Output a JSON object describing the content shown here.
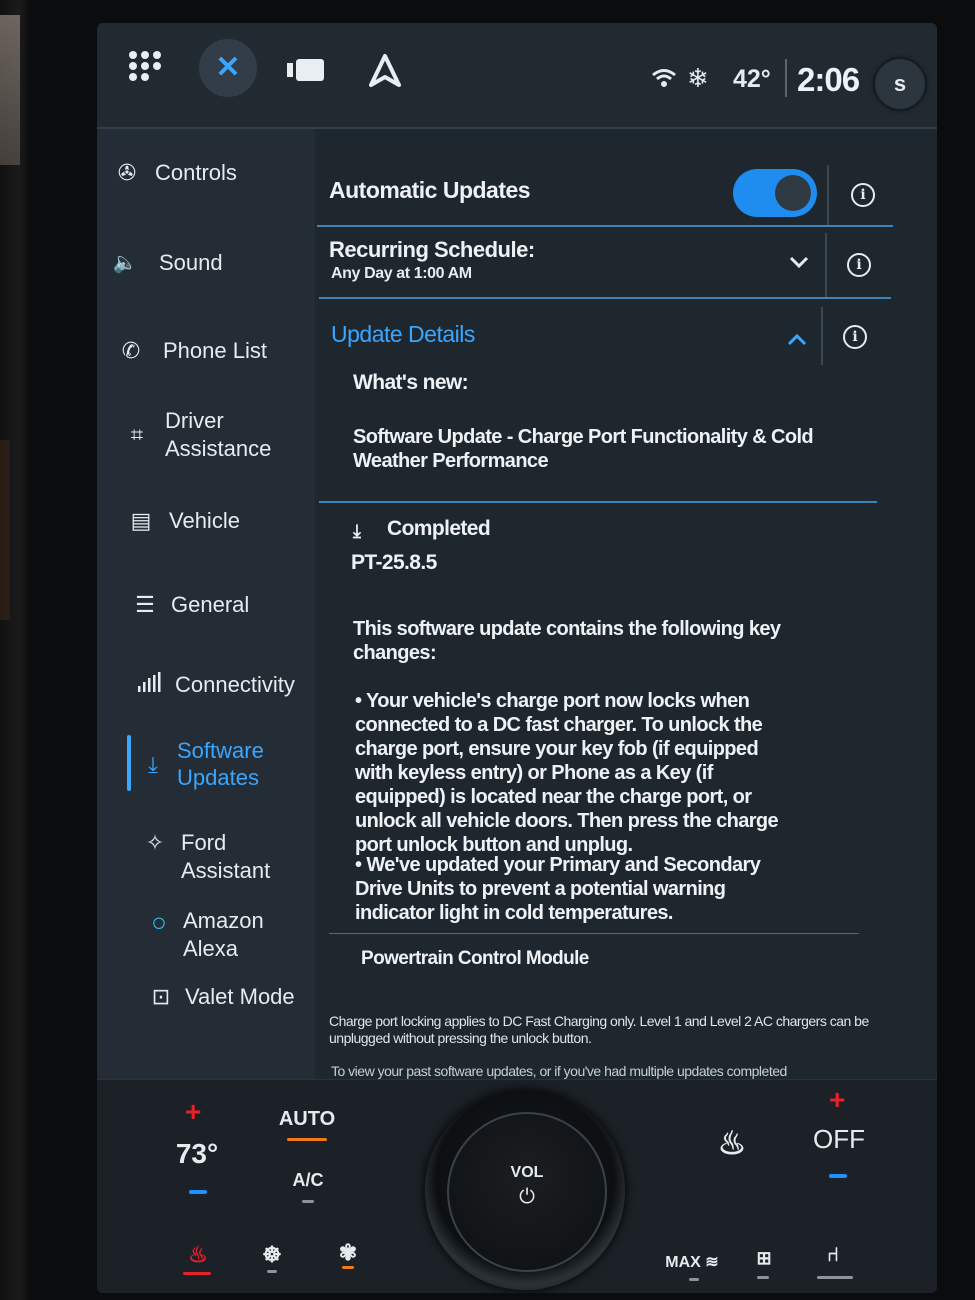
{
  "topbar": {
    "close_icon": "✕",
    "temp": "42°",
    "time": "2:06",
    "profile_initial": "s"
  },
  "sidebar": {
    "items": [
      {
        "label": "Controls",
        "icon": "✇"
      },
      {
        "label": "Sound",
        "icon": "🔈"
      },
      {
        "label": "Phone List",
        "icon": "✆"
      },
      {
        "label": "Driver\nAssistance",
        "icon": "⌗"
      },
      {
        "label": "Vehicle",
        "icon": "▤"
      },
      {
        "label": "General",
        "icon": "☰"
      },
      {
        "label": "Connectivity",
        "icon": "⫶"
      },
      {
        "label": "Software\nUpdates",
        "icon": "⤓"
      },
      {
        "label": "Ford Assistant",
        "icon": "✧"
      },
      {
        "label": "Amazon Alexa",
        "icon": "○"
      },
      {
        "label": "Valet Mode",
        "icon": "⊡"
      }
    ]
  },
  "main": {
    "automatic_updates": "Automatic Updates",
    "recurring_title": "Recurring Schedule:",
    "recurring_value": "Any Day at 1:00 AM",
    "update_details": "Update Details",
    "whats_new": "What's new:",
    "update_title": "Software Update - Charge Port Functionality & Cold Weather Performance",
    "completed": "Completed",
    "version": "PT-25.8.5",
    "intro": "This software update contains the following key changes:",
    "bullet1": "• Your vehicle's charge port now locks when connected to a DC fast charger. To unlock the charge port, ensure your key fob (if equipped with keyless entry) or Phone as a Key (if equipped) is located near the charge port, or unlock all vehicle doors. Then press the charge port unlock button and unplug.",
    "bullet2": "• We've updated your Primary and Secondary Drive Units to prevent a potential warning indicator light in cold temperatures.",
    "module": "Powertrain Control Module",
    "note": "Charge port locking applies to DC Fast Charging only. Level 1 and Level 2 AC chargers can be unplugged without pressing the unlock button.",
    "footer": "To view your past software updates, or if you've had multiple updates completed"
  },
  "climate": {
    "driver_temp": "73°",
    "auto": "AUTO",
    "ac": "A/C",
    "vol": "VOL",
    "power_symbol": "⏻",
    "passenger": "OFF",
    "max": "MAX"
  },
  "colors": {
    "accent": "#39a6ff",
    "toggle_on": "#1f8cf0",
    "heat": "#e8202a",
    "cool": "#1e90ff",
    "auto_dash": "#f07a1a"
  }
}
